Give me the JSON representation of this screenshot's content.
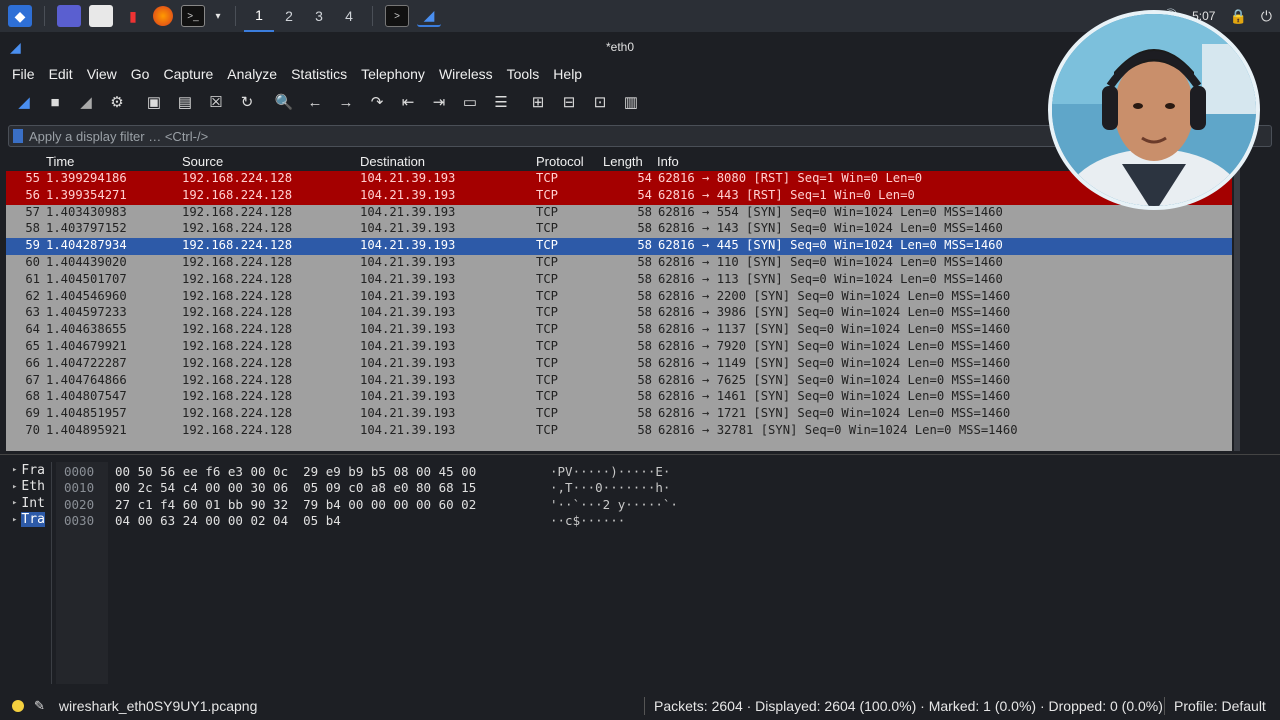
{
  "taskbar": {
    "workspaces": [
      "1",
      "2",
      "3",
      "4"
    ],
    "clock": "5:07"
  },
  "window": {
    "title": "*eth0"
  },
  "menu": [
    "File",
    "Edit",
    "View",
    "Go",
    "Capture",
    "Analyze",
    "Statistics",
    "Telephony",
    "Wireless",
    "Tools",
    "Help"
  ],
  "toolbar": {
    "icons": [
      "shark-fin-icon",
      "stop-icon",
      "restart-icon",
      "options-gear-icon",
      "open-icon",
      "save-icon",
      "close-file-icon",
      "reload-icon",
      "search-icon",
      "back-arrow-icon",
      "forward-arrow-icon",
      "go-to-packet-icon",
      "first-packet-icon",
      "last-packet-icon",
      "autoscroll-icon",
      "colorize-icon",
      "zoom-in-icon",
      "zoom-out-icon",
      "normal-size-icon",
      "resize-columns-icon"
    ]
  },
  "filter": {
    "placeholder": "Apply a display filter … <Ctrl-/>"
  },
  "packet_list": {
    "headers": {
      "time": "Time",
      "source": "Source",
      "destination": "Destination",
      "protocol": "Protocol",
      "length": "Length",
      "info": "Info"
    },
    "rows": [
      {
        "no": "55",
        "time": "1.399294186",
        "src": "192.168.224.128",
        "dst": "104.21.39.193",
        "proto": "TCP",
        "len": "54",
        "info": "62816 → 8080 [RST] Seq=1 Win=0 Len=0",
        "style": "rst"
      },
      {
        "no": "56",
        "time": "1.399354271",
        "src": "192.168.224.128",
        "dst": "104.21.39.193",
        "proto": "TCP",
        "len": "54",
        "info": "62816 → 443 [RST] Seq=1 Win=0 Len=0",
        "style": "rst"
      },
      {
        "no": "57",
        "time": "1.403430983",
        "src": "192.168.224.128",
        "dst": "104.21.39.193",
        "proto": "TCP",
        "len": "58",
        "info": "62816 → 554 [SYN] Seq=0 Win=1024 Len=0 MSS=1460",
        "style": ""
      },
      {
        "no": "58",
        "time": "1.403797152",
        "src": "192.168.224.128",
        "dst": "104.21.39.193",
        "proto": "TCP",
        "len": "58",
        "info": "62816 → 143 [SYN] Seq=0 Win=1024 Len=0 MSS=1460",
        "style": ""
      },
      {
        "no": "59",
        "time": "1.404287934",
        "src": "192.168.224.128",
        "dst": "104.21.39.193",
        "proto": "TCP",
        "len": "58",
        "info": "62816 → 445 [SYN] Seq=0 Win=1024 Len=0 MSS=1460",
        "style": "sel"
      },
      {
        "no": "60",
        "time": "1.404439020",
        "src": "192.168.224.128",
        "dst": "104.21.39.193",
        "proto": "TCP",
        "len": "58",
        "info": "62816 → 110 [SYN] Seq=0 Win=1024 Len=0 MSS=1460",
        "style": ""
      },
      {
        "no": "61",
        "time": "1.404501707",
        "src": "192.168.224.128",
        "dst": "104.21.39.193",
        "proto": "TCP",
        "len": "58",
        "info": "62816 → 113 [SYN] Seq=0 Win=1024 Len=0 MSS=1460",
        "style": ""
      },
      {
        "no": "62",
        "time": "1.404546960",
        "src": "192.168.224.128",
        "dst": "104.21.39.193",
        "proto": "TCP",
        "len": "58",
        "info": "62816 → 2200 [SYN] Seq=0 Win=1024 Len=0 MSS=1460",
        "style": ""
      },
      {
        "no": "63",
        "time": "1.404597233",
        "src": "192.168.224.128",
        "dst": "104.21.39.193",
        "proto": "TCP",
        "len": "58",
        "info": "62816 → 3986 [SYN] Seq=0 Win=1024 Len=0 MSS=1460",
        "style": ""
      },
      {
        "no": "64",
        "time": "1.404638655",
        "src": "192.168.224.128",
        "dst": "104.21.39.193",
        "proto": "TCP",
        "len": "58",
        "info": "62816 → 1137 [SYN] Seq=0 Win=1024 Len=0 MSS=1460",
        "style": ""
      },
      {
        "no": "65",
        "time": "1.404679921",
        "src": "192.168.224.128",
        "dst": "104.21.39.193",
        "proto": "TCP",
        "len": "58",
        "info": "62816 → 7920 [SYN] Seq=0 Win=1024 Len=0 MSS=1460",
        "style": ""
      },
      {
        "no": "66",
        "time": "1.404722287",
        "src": "192.168.224.128",
        "dst": "104.21.39.193",
        "proto": "TCP",
        "len": "58",
        "info": "62816 → 1149 [SYN] Seq=0 Win=1024 Len=0 MSS=1460",
        "style": ""
      },
      {
        "no": "67",
        "time": "1.404764866",
        "src": "192.168.224.128",
        "dst": "104.21.39.193",
        "proto": "TCP",
        "len": "58",
        "info": "62816 → 7625 [SYN] Seq=0 Win=1024 Len=0 MSS=1460",
        "style": ""
      },
      {
        "no": "68",
        "time": "1.404807547",
        "src": "192.168.224.128",
        "dst": "104.21.39.193",
        "proto": "TCP",
        "len": "58",
        "info": "62816 → 1461 [SYN] Seq=0 Win=1024 Len=0 MSS=1460",
        "style": ""
      },
      {
        "no": "69",
        "time": "1.404851957",
        "src": "192.168.224.128",
        "dst": "104.21.39.193",
        "proto": "TCP",
        "len": "58",
        "info": "62816 → 1721 [SYN] Seq=0 Win=1024 Len=0 MSS=1460",
        "style": ""
      },
      {
        "no": "70",
        "time": "1.404895921",
        "src": "192.168.224.128",
        "dst": "104.21.39.193",
        "proto": "TCP",
        "len": "58",
        "info": "62816 → 32781 [SYN] Seq=0 Win=1024 Len=0 MSS=1460",
        "style": ""
      }
    ]
  },
  "details": [
    {
      "label": "Fra",
      "selected": false
    },
    {
      "label": "Eth",
      "selected": false
    },
    {
      "label": "Int",
      "selected": false
    },
    {
      "label": "Tra",
      "selected": true
    }
  ],
  "bytes": [
    {
      "offset": "0000",
      "hex": "00 50 56 ee f6 e3 00 0c  29 e9 b9 b5 08 00 45 00",
      "ascii": "·PV·····)·····E·"
    },
    {
      "offset": "0010",
      "hex": "00 2c 54 c4 00 00 30 06  05 09 c0 a8 e0 80 68 15",
      "ascii": "·,T···0·······h·"
    },
    {
      "offset": "0020",
      "hex": "27 c1 f4 60 01 bb 90 32  79 b4 00 00 00 00 60 02",
      "ascii": "'··`···2 y·····`·"
    },
    {
      "offset": "0030",
      "hex": "04 00 63 24 00 00 02 04  05 b4",
      "ascii": "··c$······"
    }
  ],
  "status": {
    "file": "wireshark_eth0SY9UY1.pcapng",
    "stats": "Packets: 2604 · Displayed: 2604 (100.0%) · Marked: 1 (0.0%) · Dropped: 0 (0.0%)",
    "profile": "Profile: Default"
  },
  "colors": {
    "rst_row": "#a40000",
    "selected_row": "#2d5aa8",
    "list_bg": "#a0a0a0"
  }
}
